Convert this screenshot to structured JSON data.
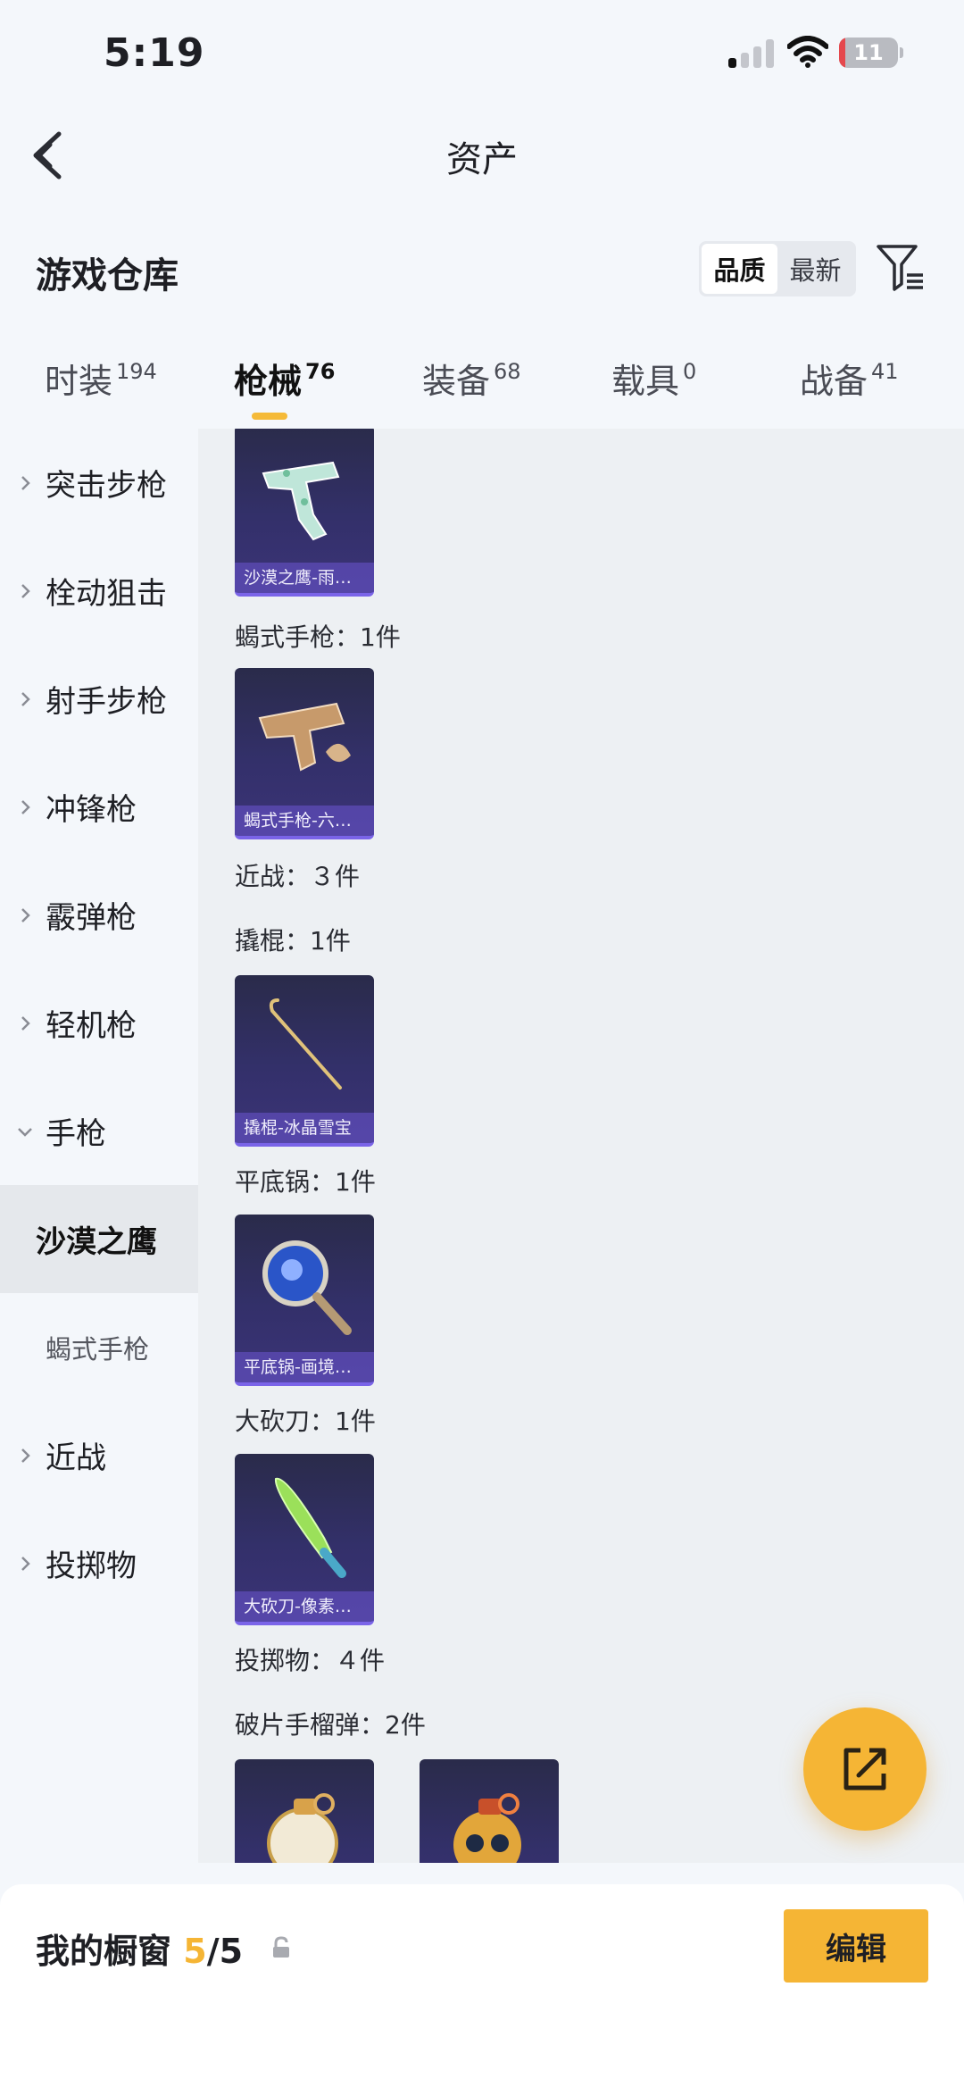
{
  "status_bar": {
    "time": "5:19",
    "battery": "11",
    "battery_level": 0.11
  },
  "nav": {
    "title": "资产"
  },
  "warehouse": {
    "title": "游戏仓库",
    "sort_options": [
      {
        "label": "品质",
        "active": true
      },
      {
        "label": "最新",
        "active": false
      }
    ]
  },
  "tabs": [
    {
      "label": "时装",
      "count": "194",
      "active": false
    },
    {
      "label": "枪械",
      "count": "76",
      "active": true
    },
    {
      "label": "装备",
      "count": "68",
      "active": false
    },
    {
      "label": "载具",
      "count": "0",
      "active": false
    },
    {
      "label": "战备",
      "count": "41",
      "active": false
    }
  ],
  "sidebar": {
    "items": [
      {
        "label": "突击步枪"
      },
      {
        "label": "栓动狙击"
      },
      {
        "label": "射手步枪"
      },
      {
        "label": "冲锋枪"
      },
      {
        "label": "霰弹枪"
      },
      {
        "label": "轻机枪"
      },
      {
        "label": "手枪",
        "expanded": true
      },
      {
        "label": "沙漠之鹰",
        "selected": true
      },
      {
        "label": "蝎式手枪"
      },
      {
        "label": "近战"
      },
      {
        "label": "投掷物"
      }
    ]
  },
  "content": {
    "labels": {
      "scorpion": "蝎式手枪：1件",
      "melee": "近战：３件",
      "crowbar": "撬棍：1件",
      "pan": "平底锅：1件",
      "machete": "大砍刀：1件",
      "throwables": "投掷物：４件",
      "frag": "破片手榴弹：2件"
    },
    "cards": {
      "deagle": "沙漠之鹰-雨林蝶影",
      "scorpion": "蝎式手枪-六翼天使",
      "crowbar": "撬棍-冰晶雪宝",
      "pan": "平底锅-画境星辰",
      "machete": "大砍刀-像素绿刃"
    }
  },
  "bottom_bar": {
    "title": "我的橱窗",
    "count_current": "5",
    "count_sep": "/",
    "count_total": "5",
    "edit_label": "编辑"
  },
  "colors": {
    "accent": "#f5b535",
    "card_purple": "#3b3377",
    "battery_red": "#e5484d"
  },
  "icons": [
    "back-arrow-icon",
    "filter-icon",
    "chevron-right-icon",
    "chevron-down-icon",
    "share-icon",
    "lock-icon",
    "signal-icon",
    "wifi-icon",
    "battery-icon"
  ]
}
